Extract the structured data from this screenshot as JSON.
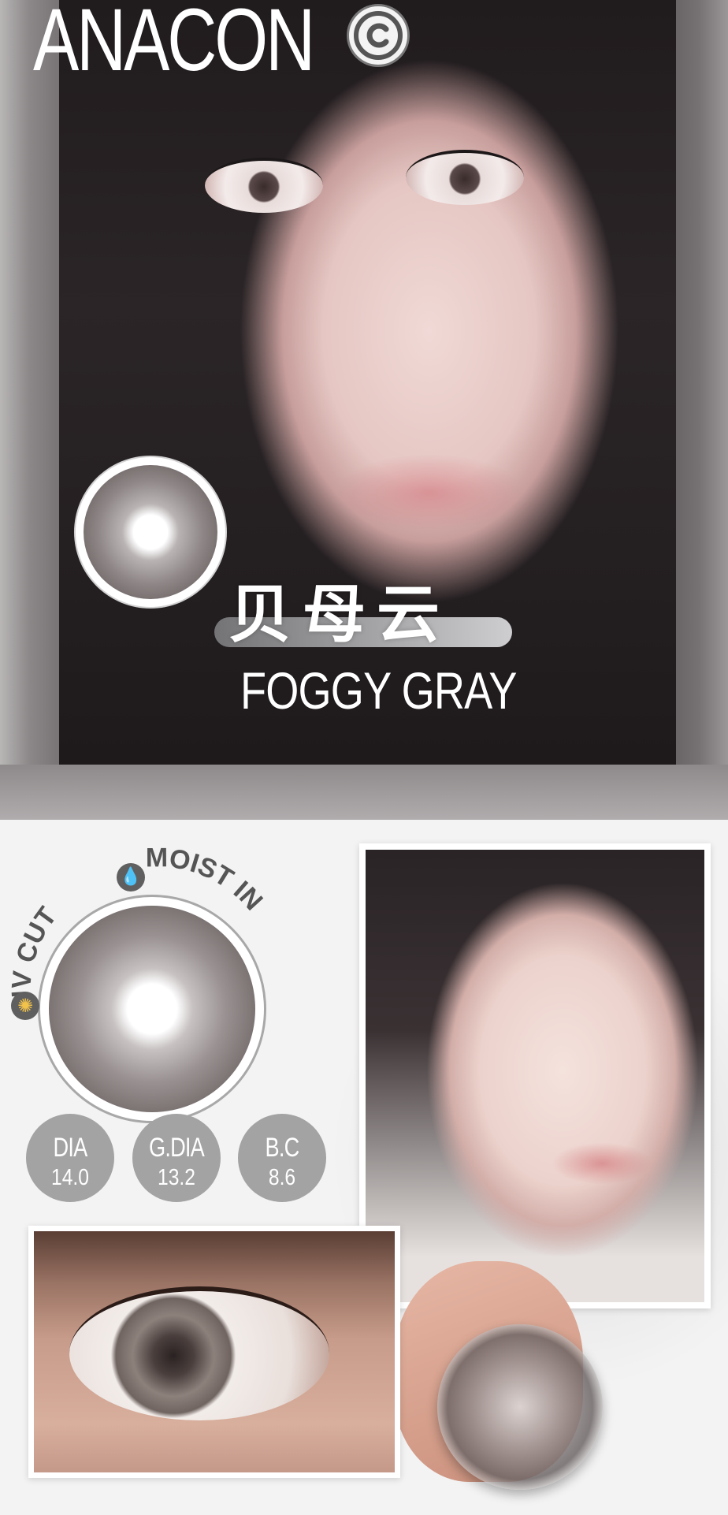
{
  "brand": {
    "name": "ANACON",
    "symbol": "©"
  },
  "product": {
    "name_cn": "贝母云",
    "name_en": "FOGGY GRAY"
  },
  "features": {
    "uv": "UV CUT",
    "moist": "MOIST IN"
  },
  "specs": [
    {
      "label": "DIA",
      "value": "14.0"
    },
    {
      "label": "G.DIA",
      "value": "13.2"
    },
    {
      "label": "B.C",
      "value": "8.6"
    }
  ],
  "colors": {
    "spec_circle": "#a3a3a3",
    "text": "#ffffff",
    "background": "#f3f3f3"
  },
  "icons": {
    "uv": "sun-icon",
    "moist": "water-drop-icon",
    "brand": "copyright-icon"
  }
}
